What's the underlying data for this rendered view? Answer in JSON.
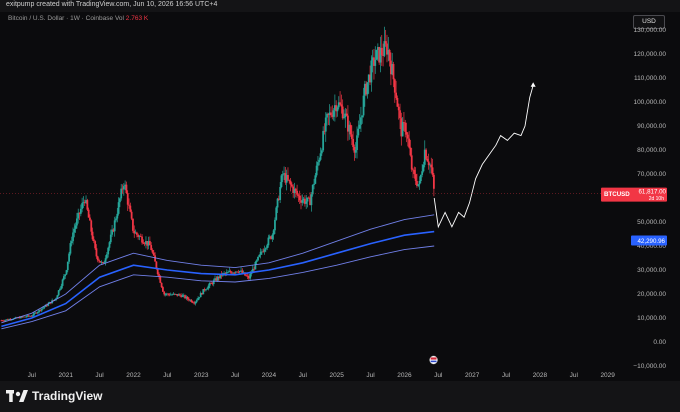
{
  "header": {
    "credit": "exitpump created with TradingView.com, Jun 10, 2026 16:56 UTC+4"
  },
  "symbol": {
    "name": "Bitcoin / U.S. Dollar · 1W · Coinbase",
    "vol_label": "Vol",
    "vol_value": "2.763 K"
  },
  "currency_button": "USD",
  "footer": {
    "brand": "TradingView"
  },
  "colors": {
    "up": "#26a69a",
    "down": "#f23645",
    "band": "#2962ff",
    "projection": "#ffffff",
    "background": "#0b0b0d"
  },
  "chart_data": {
    "type": "candlestick",
    "series_label": "BTCUSD",
    "last_price": {
      "value": 61817,
      "label": "61,817.00",
      "sub_label": "2d 10h"
    },
    "band_label": {
      "value": 42290.96,
      "label": "42,290.96"
    },
    "ylim": [
      -10000,
      130000
    ],
    "y_ticks": [
      {
        "value": 130000,
        "label": "130,000.00"
      },
      {
        "value": 120000,
        "label": "120,000.00"
      },
      {
        "value": 110000,
        "label": "110,000.00"
      },
      {
        "value": 100000,
        "label": "100,000.00"
      },
      {
        "value": 90000,
        "label": "90,000.00"
      },
      {
        "value": 80000,
        "label": "80,000.00"
      },
      {
        "value": 70000,
        "label": "70,000.00"
      },
      {
        "value": 50000,
        "label": "50,000.00"
      },
      {
        "value": 40000,
        "label": "40,000.00"
      },
      {
        "value": 30000,
        "label": "30,000.00"
      },
      {
        "value": 20000,
        "label": "20,000.00"
      },
      {
        "value": 10000,
        "label": "10,000.00"
      },
      {
        "value": 0,
        "label": "0.00"
      },
      {
        "value": -10000,
        "label": "−10,000.00"
      }
    ],
    "x_ticks": [
      {
        "t": 2020.5,
        "label": "Jul"
      },
      {
        "t": 2021.0,
        "label": "2021"
      },
      {
        "t": 2021.5,
        "label": "Jul"
      },
      {
        "t": 2022.0,
        "label": "2022"
      },
      {
        "t": 2022.5,
        "label": "Jul"
      },
      {
        "t": 2023.0,
        "label": "2023"
      },
      {
        "t": 2023.5,
        "label": "Jul"
      },
      {
        "t": 2024.0,
        "label": "2024"
      },
      {
        "t": 2024.5,
        "label": "Jul"
      },
      {
        "t": 2025.0,
        "label": "2025"
      },
      {
        "t": 2025.5,
        "label": "Jul"
      },
      {
        "t": 2026.0,
        "label": "2026"
      },
      {
        "t": 2026.5,
        "label": "Jul"
      },
      {
        "t": 2027.0,
        "label": "2027"
      },
      {
        "t": 2027.5,
        "label": "Jul"
      },
      {
        "t": 2028.0,
        "label": "2028"
      },
      {
        "t": 2028.5,
        "label": "Jul"
      },
      {
        "t": 2029.0,
        "label": "2029"
      }
    ],
    "xlim": [
      2020.03,
      2029.3
    ],
    "price_path": [
      [
        2020.05,
        9000
      ],
      [
        2020.5,
        11000
      ],
      [
        2020.85,
        18000
      ],
      [
        2021.0,
        29000
      ],
      [
        2021.1,
        45000
      ],
      [
        2021.28,
        60000
      ],
      [
        2021.45,
        36000
      ],
      [
        2021.55,
        32000
      ],
      [
        2021.7,
        47000
      ],
      [
        2021.86,
        67000
      ],
      [
        2022.0,
        46000
      ],
      [
        2022.25,
        40000
      ],
      [
        2022.45,
        20000
      ],
      [
        2022.7,
        19500
      ],
      [
        2022.9,
        16500
      ],
      [
        2023.05,
        22000
      ],
      [
        2023.3,
        28000
      ],
      [
        2023.55,
        30000
      ],
      [
        2023.7,
        26500
      ],
      [
        2023.9,
        38000
      ],
      [
        2024.05,
        45000
      ],
      [
        2024.2,
        70000
      ],
      [
        2024.45,
        60000
      ],
      [
        2024.6,
        58000
      ],
      [
        2024.85,
        92000
      ],
      [
        2025.0,
        100000
      ],
      [
        2025.1,
        96000
      ],
      [
        2025.28,
        80000
      ],
      [
        2025.42,
        105000
      ],
      [
        2025.56,
        118000
      ],
      [
        2025.75,
        123000
      ],
      [
        2025.87,
        105000
      ],
      [
        2025.95,
        88000
      ],
      [
        2026.02,
        90000
      ],
      [
        2026.12,
        70000
      ],
      [
        2026.22,
        65000
      ],
      [
        2026.3,
        80000
      ],
      [
        2026.4,
        72000
      ],
      [
        2026.44,
        61817
      ]
    ],
    "band_upper": [
      [
        2020.05,
        8000
      ],
      [
        2020.5,
        12000
      ],
      [
        2021.0,
        20000
      ],
      [
        2021.5,
        32000
      ],
      [
        2022.0,
        37000
      ],
      [
        2022.5,
        34000
      ],
      [
        2023.0,
        32000
      ],
      [
        2023.5,
        31000
      ],
      [
        2024.0,
        33000
      ],
      [
        2024.5,
        37000
      ],
      [
        2025.0,
        42000
      ],
      [
        2025.5,
        47000
      ],
      [
        2026.0,
        51000
      ],
      [
        2026.44,
        53000
      ]
    ],
    "band_mid": [
      [
        2020.05,
        6500
      ],
      [
        2020.5,
        10000
      ],
      [
        2021.0,
        16000
      ],
      [
        2021.5,
        27000
      ],
      [
        2022.0,
        32000
      ],
      [
        2022.5,
        30000
      ],
      [
        2023.0,
        28500
      ],
      [
        2023.5,
        28000
      ],
      [
        2024.0,
        30000
      ],
      [
        2024.5,
        33000
      ],
      [
        2025.0,
        37000
      ],
      [
        2025.5,
        41000
      ],
      [
        2026.0,
        44500
      ],
      [
        2026.44,
        46000
      ]
    ],
    "band_lower": [
      [
        2020.05,
        5500
      ],
      [
        2020.5,
        8500
      ],
      [
        2021.0,
        13000
      ],
      [
        2021.5,
        23000
      ],
      [
        2022.0,
        28000
      ],
      [
        2022.5,
        27000
      ],
      [
        2023.0,
        25500
      ],
      [
        2023.5,
        25000
      ],
      [
        2024.0,
        26500
      ],
      [
        2024.5,
        29000
      ],
      [
        2025.0,
        32000
      ],
      [
        2025.5,
        35500
      ],
      [
        2026.0,
        38500
      ],
      [
        2026.44,
        40000
      ]
    ],
    "projection": [
      [
        2026.44,
        60000
      ],
      [
        2026.5,
        48000
      ],
      [
        2026.6,
        54000
      ],
      [
        2026.7,
        48000
      ],
      [
        2026.8,
        54000
      ],
      [
        2026.88,
        52000
      ],
      [
        2026.96,
        58000
      ],
      [
        2027.05,
        68000
      ],
      [
        2027.15,
        74000
      ],
      [
        2027.25,
        78000
      ],
      [
        2027.35,
        82000
      ],
      [
        2027.42,
        86000
      ],
      [
        2027.52,
        84000
      ],
      [
        2027.62,
        87000
      ],
      [
        2027.72,
        86000
      ],
      [
        2027.78,
        90000
      ],
      [
        2027.85,
        102000
      ],
      [
        2027.9,
        107000
      ]
    ],
    "grid": false,
    "legend": "none"
  }
}
